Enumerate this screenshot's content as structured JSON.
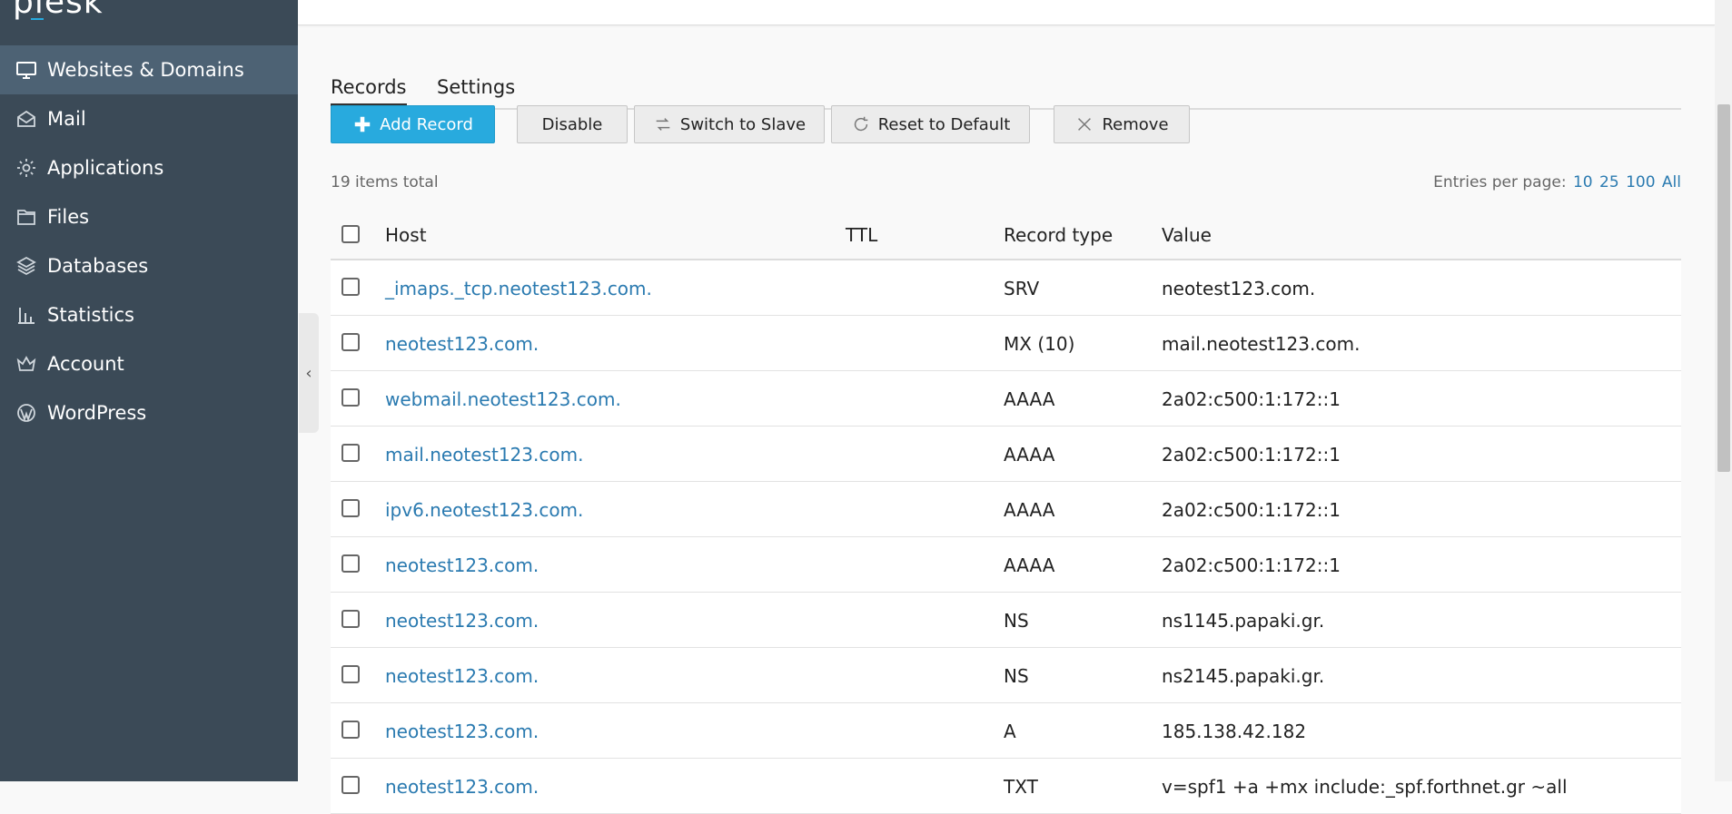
{
  "app": {
    "logo": "plesk"
  },
  "sidebar": {
    "items": [
      {
        "label": "Websites & Domains",
        "icon": "monitor-icon",
        "active": true
      },
      {
        "label": "Mail",
        "icon": "mail-icon"
      },
      {
        "label": "Applications",
        "icon": "gear-icon"
      },
      {
        "label": "Files",
        "icon": "folder-icon"
      },
      {
        "label": "Databases",
        "icon": "database-icon"
      },
      {
        "label": "Statistics",
        "icon": "bar-chart-icon"
      },
      {
        "label": "Account",
        "icon": "crown-icon"
      },
      {
        "label": "WordPress",
        "icon": "wordpress-icon"
      }
    ]
  },
  "tabs": [
    {
      "label": "Records",
      "active": true
    },
    {
      "label": "Settings"
    }
  ],
  "toolbar": {
    "add_record": "Add Record",
    "disable": "Disable",
    "switch_to_slave": "Switch to Slave",
    "reset_to_default": "Reset to Default",
    "remove": "Remove"
  },
  "list_info": {
    "items_total": "19 items total",
    "entries_label": "Entries per page:",
    "entries_options": [
      "10",
      "25",
      "100",
      "All"
    ]
  },
  "table": {
    "headers": {
      "host": "Host",
      "ttl": "TTL",
      "type": "Record type",
      "value": "Value"
    },
    "rows": [
      {
        "host": "_imaps._tcp.neotest123.com.",
        "ttl": "",
        "type": "SRV",
        "value": "neotest123.com."
      },
      {
        "host": "neotest123.com.",
        "ttl": "",
        "type": "MX (10)",
        "value": "mail.neotest123.com."
      },
      {
        "host": "webmail.neotest123.com.",
        "ttl": "",
        "type": "AAAA",
        "value": "2a02:c500:1:172::1"
      },
      {
        "host": "mail.neotest123.com.",
        "ttl": "",
        "type": "AAAA",
        "value": "2a02:c500:1:172::1"
      },
      {
        "host": "ipv6.neotest123.com.",
        "ttl": "",
        "type": "AAAA",
        "value": "2a02:c500:1:172::1"
      },
      {
        "host": "neotest123.com.",
        "ttl": "",
        "type": "AAAA",
        "value": "2a02:c500:1:172::1"
      },
      {
        "host": "neotest123.com.",
        "ttl": "",
        "type": "NS",
        "value": "ns1145.papaki.gr."
      },
      {
        "host": "neotest123.com.",
        "ttl": "",
        "type": "NS",
        "value": "ns2145.papaki.gr."
      },
      {
        "host": "neotest123.com.",
        "ttl": "",
        "type": "A",
        "value": "185.138.42.182"
      },
      {
        "host": "neotest123.com.",
        "ttl": "",
        "type": "TXT",
        "value": "v=spf1 +a +mx include:_spf.forthnet.gr ~all"
      }
    ]
  },
  "colors": {
    "sidebar": "#3b4a57",
    "sidebar_active": "#4d6274",
    "primary": "#28aade",
    "link": "#2a7ab0"
  }
}
